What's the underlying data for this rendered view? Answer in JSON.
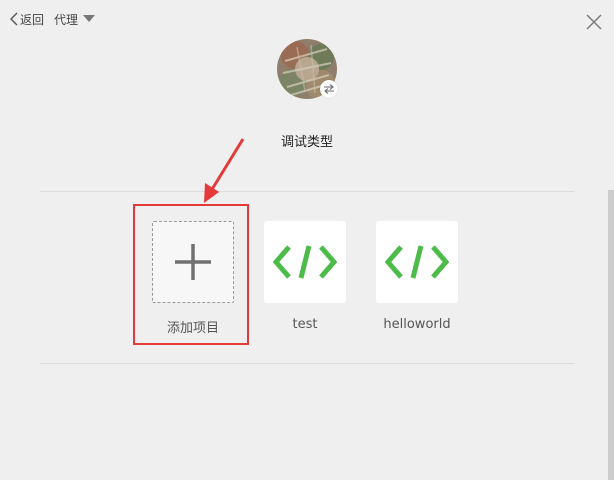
{
  "nav": {
    "back_label": "返回",
    "proxy_label": "代理"
  },
  "section": {
    "title": "调试类型"
  },
  "tiles": [
    {
      "label": "添加项目",
      "icon": "plus-icon"
    },
    {
      "label": "test",
      "icon": "code-icon"
    },
    {
      "label": "helloworld",
      "icon": "code-icon"
    }
  ],
  "colors": {
    "background": "#efefef",
    "code_icon": "#4cbb4a",
    "highlight": "#e43a3a",
    "plus_icon": "#707070"
  }
}
